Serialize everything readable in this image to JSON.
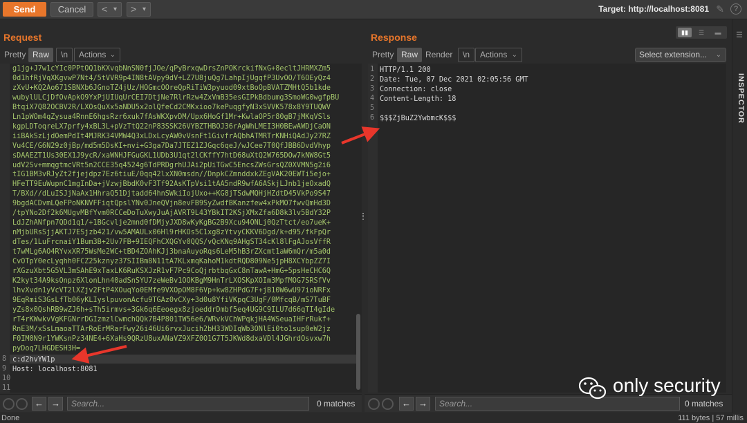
{
  "toolbar": {
    "send_label": "Send",
    "cancel_label": "Cancel",
    "back_icon": "<",
    "forward_icon": ">",
    "dropdown_icon": "▾",
    "target_text": "Target: http://localhost:8081"
  },
  "request": {
    "title": "Request",
    "tabs": [
      "Pretty",
      "Raw",
      "\\n"
    ],
    "actions_label": "Actions",
    "body_lines": [
      "g1jg+J7w1cYIc0PPtOQ1bKXvqbNnSN0fjJOe/qPyBrxqwDrsZnPOKrckifNxG+8ecltJHRMXZm5",
      "0d1hfRjVqXKgvwP7Nt4/5tVVR9p4IN8tAVpy9dV+LZ7U8juQg7LahpIjUgqfP3UvOO/T6OEyQz4",
      "zXvU+KQ2Ao671SBNXb6JGnoTZ4jUz/HOGmcOOreQpRiTiW3pyuod09xtBoOpBVATZMHtQ5b1kde",
      "wubylULCjDfOvApkO9YxPjUIUqUrCEI7DtjNe7RlrRzw4ZxVmB35esGIPkBdbumg3SmoWG0wgfpBU",
      "BtqiX7Q82OCBV2R/LXOsQuXx5aNDU5x2olQfeCd2CMKxioo7kePuqgfyN3xSVVK578x8Y9TUQWV",
      "Ln1pWOm4qZysua4RnnE6hgsRzr6xuk7fAsWKXpvDM/Upx6HoGf1Mr+KwlaOP5r80gB7jMKqVSls",
      "kgpLDToqreLX7prfy4xBL3L+pVzTtQ22nP83SSK26VYBZTHBOJ36rAgWhLMEI3H0BEwAWDjCaON",
      "iiBAkSzLjdOemPdIt4MJRK34VMW4Q3xLDxLcyAW0vVsnFt1GivfrAQbhATMRTrKNHiQAdJy27RZ",
      "Vu4CE/G6N29z0jBp/md5m5DsKI+nvi+G3ga7Da7JTEZ1ZJGqc6qeJ/wJCee7T0QfJBB6DvdVhyp",
      "sDAAEZT1Us30EX1J9ycR/xaWNHJFGuGKL1UDb3U1qt2lCKffY7htD68uXtQ2W765DOw7kNW8Gt5",
      "udV2Sv+mmqgtmcVRt5n2CCE35q4524g6TdPRDgrhUJAi2pUiTGwC5EncsZWsGrsQZ0XVMN5g2i6",
      "tIG1BM3vRJyZt2fjejdpz7Ez6tiuE/0qq42lxXN0msdn//DnpkCZmnddxkZEgVAK20EWTi5ejo+",
      "HFeTT9EuWupnC1mgInDa+jVzwjBbdK0vF3Tf92AsKTpVsi1tAA5ndR9wfA6ASkjLJnb1jeOxadQ",
      "T/BXd//dLuISJjNaAx1HhraQ51Djtadd64hnSWkiIojUxo++KG8jTSdwMQHjHZdtD45VkPo9S47",
      "9bgdACDvmLQeFPoNKNVFFiqtQpslYNv0JneQVjn8evFB9SyZwdfBKanzfew4xPkMO7fwvQmHd3D",
      "/tpYNo2Df2k6MUgvMBfYvm0RCCeDoTuXwyJuAjAVRT9L43YBkIT2KSjXMxZfa6D8k3lv5BdY32P",
      "LdJZhANfpn7QDd1q1/+1BGcvlje2mnd0fDMjyJXD8wKyKgBG2B9Xcu94ONLj0QzTtct/eo7ueK+",
      "nMjbURsSjjAKTJ7ESjzb421/vw5AMAULx06Hl9rHKOs5C1xg8zYtvyCKKV6Dgd/k+d95/fkFpQr",
      "dTes/1LuFrcnaiY1Bum3B+2Uv7FB+9IEQFhCXQGYv0QQS/vQcKNq9AHgST34cKl8lFgAJosVffR",
      "t7wMLg6AO4RYvxXR75WsMe2WC+tBD4ZOAhKJj3bnaAuyoRqs6LeM5hB3rZXcmt1aW6mQr/m5a0d",
      "CvOTpY0ecLyqhh0FCZ25kznyz37SIIBm8N11tA7KLxmqKahoM1kdtRQD809Ne5jpH8XCYbpZZ7I",
      "rXGzuXbt5G5VL3mSAhE9xTaxLK6RuKSXJzR1vF7Pc9CoQjrbtbqGxC8nTawA+HmG+5psHeCHC6Q",
      "K2kyt34A9ksOnpz6XlonLhn40adSnSYU7zeWeBv1OOKBgM9HnTrLXOSKpXOIm3MpfMOG7SRSfVv",
      "lhvXvdn1yVcVT2lXZjv2FtP4XOuqYo0EMfe9VXOpOM8F6Vp+kw8ZHPdG7F+jB10W6wU97ioNRFx",
      "9EqRmiS3GsLfTb06yKLIyslpuvonAcfu9TGAz0vCXy+3d0u8YfiVKpqC3UgF/0MfcqB/mS7TuBF",
      "yZs8x0QshRB9wZJ6h+sTh5irmvs+3Gk6q6Eeoegx8zjoeddrDmbf5eq4UG9C9ILU7d66qTI4gIde",
      "rT4rKWwkvVgKFGNrrDGIzmzlCwmchQQk7B4P801TW56e6/WRvkVChWPqkjHA4WSeuaIHFrRukf+",
      "RnE3M/xSsLmaoaTTArRoErMRarFwy26i46Ui6rvxJucih2bH33WDIqWb3ONlEi0to1sup0eW2jz",
      "F0IM0N9r1YWKsnPz34NE4+6XaHs9QRzU8uxANaVZ9XFZ0O1G7T5JKWd8dxaVDl4JGhrdOsvxw7h",
      "pyDoq7LHGDESH3H="
    ],
    "line8": "c:d2hvYW1p",
    "line9": "Host: localhost:8081",
    "line_numbers": [
      "8",
      "9",
      "10",
      "11"
    ],
    "search_placeholder": "Search...",
    "matches_text": "0 matches"
  },
  "response": {
    "title": "Response",
    "tabs": [
      "Pretty",
      "Raw",
      "Render",
      "\\n"
    ],
    "actions_label": "Actions",
    "select_extension_label": "Select extension...",
    "lines": [
      "HTTP/1.1 200",
      "Date: Tue, 07 Dec 2021 02:05:56 GMT",
      "Connection: close",
      "Content-Length: 18",
      "",
      "$$$ZjBuZ2YwbmcK$$$"
    ],
    "line_numbers": [
      "1",
      "2",
      "3",
      "4",
      "5",
      "6"
    ],
    "search_placeholder": "Search...",
    "matches_text": "0 matches"
  },
  "inspector_label": "INSPECTOR",
  "status": {
    "left": "Done",
    "right": "111 bytes | 57 millis"
  },
  "watermark": "only security",
  "colors": {
    "accent": "#e8762b",
    "base64_text": "#a3c46a",
    "annotation_arrow": "#e8362b"
  }
}
